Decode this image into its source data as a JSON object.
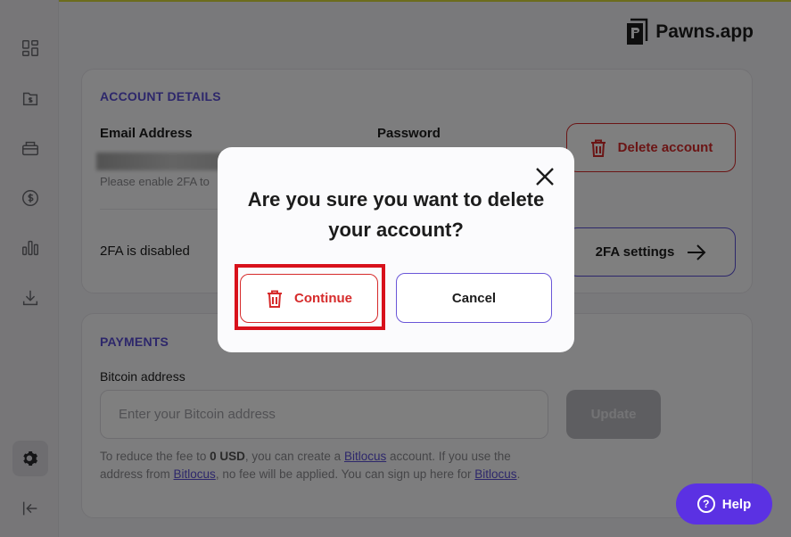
{
  "brand": {
    "name": "Pawns.app"
  },
  "sidebar": {
    "items": [
      {
        "icon": "dashboard-icon"
      },
      {
        "icon": "earnings-file-icon"
      },
      {
        "icon": "card-icon"
      },
      {
        "icon": "dollar-circle-icon"
      },
      {
        "icon": "statistics-icon"
      },
      {
        "icon": "download-icon"
      },
      {
        "icon": "settings-gear-icon",
        "active": true
      },
      {
        "icon": "logout-icon"
      }
    ]
  },
  "account": {
    "section_title": "ACCOUNT DETAILS",
    "email_label": "Email Address",
    "password_label": "Password",
    "password_hint": "Please enable 2FA to",
    "delete_label": "Delete account",
    "twofa_status": "2FA is disabled",
    "twofa_button": "2FA settings"
  },
  "payments": {
    "section_title": "PAYMENTS",
    "bitcoin_label": "Bitcoin address",
    "bitcoin_placeholder": "Enter your Bitcoin address",
    "bitcoin_value": "",
    "update_label": "Update",
    "fee_text_1": "To reduce the fee to ",
    "fee_amount": "0 USD",
    "fee_text_2": ", you can create a ",
    "fee_link_1": "Bitlocus",
    "fee_text_3": " account. If you use the address from ",
    "fee_link_2": "Bitlocus",
    "fee_text_4": ", no fee will be applied. You can sign up here for ",
    "fee_link_3": "Bitlocus",
    "fee_text_5": "."
  },
  "modal": {
    "title": "Are you sure you want to delete your account?",
    "continue_label": "Continue",
    "cancel_label": "Cancel"
  },
  "help": {
    "label": "Help"
  },
  "colors": {
    "accent": "#5b4fd6",
    "danger": "#d62b2b",
    "help_button": "#5b31e3",
    "highlight": "#d8111b"
  }
}
